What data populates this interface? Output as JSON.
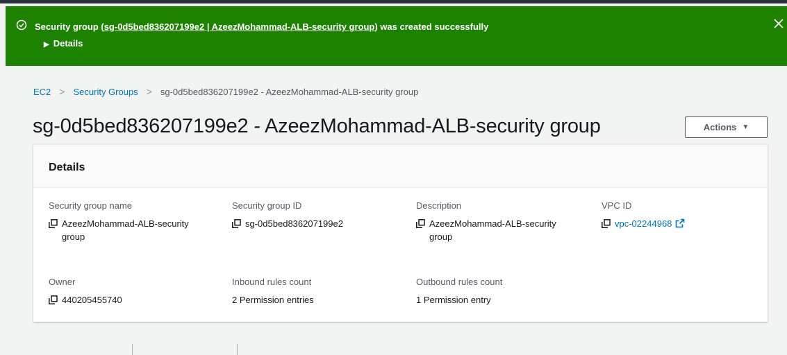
{
  "flash": {
    "prefix": "Security group (",
    "link_text": "sg-0d5bed836207199e2 | AzeezMohammad-ALB-security group",
    "suffix": ") was created successfully",
    "details_label": "Details",
    "bg_color": "#1d8102",
    "status_icon": "check-circle-icon",
    "close_icon": "close-icon"
  },
  "breadcrumb": {
    "items": [
      "EC2",
      "Security Groups"
    ],
    "current": "sg-0d5bed836207199e2 - AzeezMohammad-ALB-security group"
  },
  "page": {
    "title": "sg-0d5bed836207199e2 - AzeezMohammad-ALB-security group",
    "actions_label": "Actions"
  },
  "details": {
    "heading": "Details",
    "fields": [
      {
        "label": "Security group name",
        "value": "AzeezMohammad-ALB-security group",
        "copy": true
      },
      {
        "label": "Security group ID",
        "value": "sg-0d5bed836207199e2",
        "copy": true
      },
      {
        "label": "Description",
        "value": "AzeezMohammad-ALB-security group",
        "copy": true
      },
      {
        "label": "VPC ID",
        "value": "vpc-02244968",
        "copy": true,
        "link": true,
        "external": true
      },
      {
        "label": "Owner",
        "value": "440205455740",
        "copy": true
      },
      {
        "label": "Inbound rules count",
        "value": "2 Permission entries"
      },
      {
        "label": "Outbound rules count",
        "value": "1 Permission entry"
      }
    ]
  },
  "colors": {
    "link": "#0073bb",
    "success": "#1d8102",
    "tab_active": "#ec7211"
  }
}
